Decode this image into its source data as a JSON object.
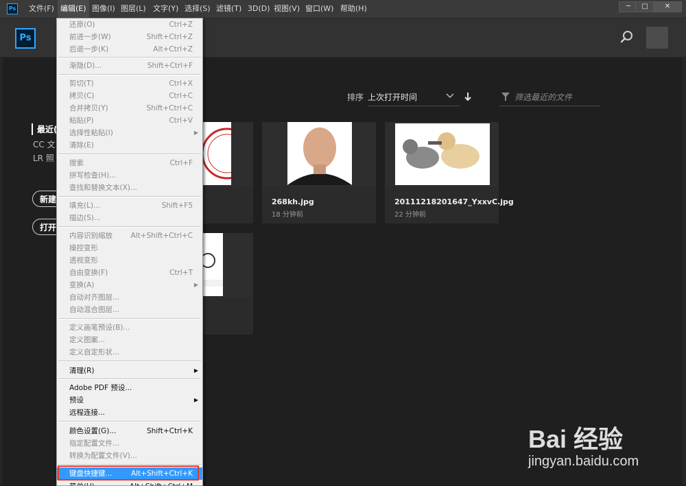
{
  "menubar": {
    "app_icon": "Ps",
    "items": [
      "文件(F)",
      "编辑(E)",
      "图像(I)",
      "图层(L)",
      "文字(Y)",
      "选择(S)",
      "滤镜(T)",
      "3D(D)",
      "视图(V)",
      "窗口(W)",
      "帮助(H)"
    ],
    "window_buttons": [
      "─",
      "□",
      "✕"
    ]
  },
  "header": {
    "logo": "Ps",
    "search_icon": "search-icon"
  },
  "left_nav": {
    "selected": "最近(",
    "items": [
      "CC 文",
      "LR 照"
    ],
    "buttons": [
      "新建",
      "打开"
    ]
  },
  "sort": {
    "label": "排序",
    "value": "上次打开时间"
  },
  "filter": {
    "placeholder": "筛选最近的文件"
  },
  "files": [
    {
      "name": "268kh.jpg",
      "time": "18 分钟前"
    },
    {
      "name": "20111218201647_YxxvC.jpg",
      "time": "22 分钟前"
    }
  ],
  "edit_menu": {
    "items": [
      {
        "label": "还原(O)",
        "shortcut": "Ctrl+Z",
        "enabled": false
      },
      {
        "label": "前进一步(W)",
        "shortcut": "Shift+Ctrl+Z",
        "enabled": false
      },
      {
        "label": "后退一步(K)",
        "shortcut": "Alt+Ctrl+Z",
        "enabled": false
      },
      {
        "label": "渐隐(D)...",
        "shortcut": "Shift+Ctrl+F",
        "enabled": false
      },
      {
        "label": "剪切(T)",
        "shortcut": "Ctrl+X",
        "enabled": false
      },
      {
        "label": "拷贝(C)",
        "shortcut": "Ctrl+C",
        "enabled": false
      },
      {
        "label": "合并拷贝(Y)",
        "shortcut": "Shift+Ctrl+C",
        "enabled": false
      },
      {
        "label": "粘贴(P)",
        "shortcut": "Ctrl+V",
        "enabled": false
      },
      {
        "label": "选择性粘贴(I)",
        "shortcut": "",
        "enabled": false,
        "submenu": true
      },
      {
        "label": "清除(E)",
        "shortcut": "",
        "enabled": false
      },
      {
        "label": "搜索",
        "shortcut": "Ctrl+F",
        "enabled": false
      },
      {
        "label": "拼写检查(H)...",
        "shortcut": "",
        "enabled": false
      },
      {
        "label": "查找和替换文本(X)...",
        "shortcut": "",
        "enabled": false
      },
      {
        "label": "填充(L)...",
        "shortcut": "Shift+F5",
        "enabled": false
      },
      {
        "label": "描边(S)...",
        "shortcut": "",
        "enabled": false
      },
      {
        "label": "内容识别缩放",
        "shortcut": "Alt+Shift+Ctrl+C",
        "enabled": false
      },
      {
        "label": "操控变形",
        "shortcut": "",
        "enabled": false
      },
      {
        "label": "透视变形",
        "shortcut": "",
        "enabled": false
      },
      {
        "label": "自由变换(F)",
        "shortcut": "Ctrl+T",
        "enabled": false
      },
      {
        "label": "变换(A)",
        "shortcut": "",
        "enabled": false,
        "submenu": true
      },
      {
        "label": "自动对齐图层...",
        "shortcut": "",
        "enabled": false
      },
      {
        "label": "自动混合图层...",
        "shortcut": "",
        "enabled": false
      },
      {
        "label": "定义画笔预设(B)...",
        "shortcut": "",
        "enabled": false
      },
      {
        "label": "定义图案...",
        "shortcut": "",
        "enabled": false
      },
      {
        "label": "定义自定形状...",
        "shortcut": "",
        "enabled": false
      },
      {
        "label": "清理(R)",
        "shortcut": "",
        "enabled": true,
        "submenu": true
      },
      {
        "label": "Adobe PDF 预设...",
        "shortcut": "",
        "enabled": true
      },
      {
        "label": "预设",
        "shortcut": "",
        "enabled": true,
        "submenu": true
      },
      {
        "label": "远程连接...",
        "shortcut": "",
        "enabled": true
      },
      {
        "label": "颜色设置(G)...",
        "shortcut": "Shift+Ctrl+K",
        "enabled": true
      },
      {
        "label": "指定配置文件...",
        "shortcut": "",
        "enabled": false
      },
      {
        "label": "转换为配置文件(V)...",
        "shortcut": "",
        "enabled": false
      },
      {
        "label": "键盘快捷键...",
        "shortcut": "Alt+Shift+Ctrl+K",
        "enabled": true,
        "highlighted": true
      },
      {
        "label": "菜单(U)...",
        "shortcut": "Alt+Shift+Ctrl+M",
        "enabled": true
      }
    ]
  },
  "watermark": {
    "logo": "Bai 经验",
    "url": "jingyan.baidu.com"
  },
  "colors": {
    "accent": "#31a8ff",
    "highlight": "#3399ff",
    "annotation": "#e53935"
  }
}
